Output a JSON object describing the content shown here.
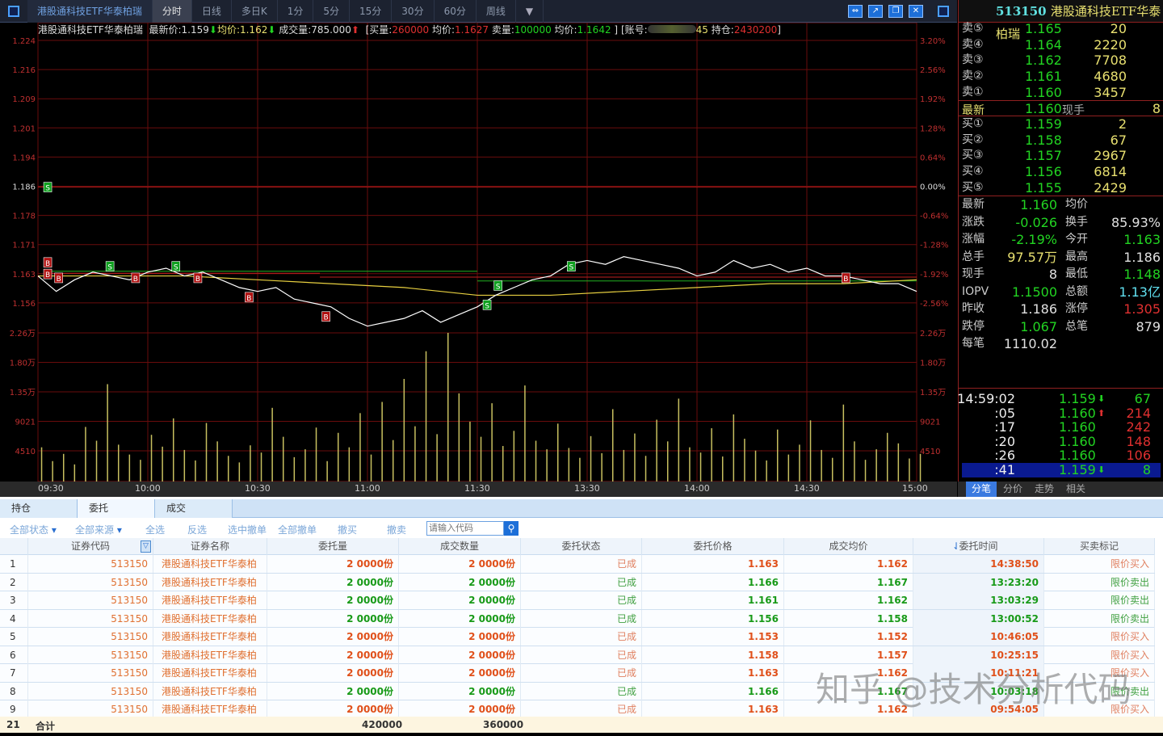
{
  "topbar": {
    "title": "港股通科技ETF华泰柏瑞",
    "tabs": [
      "分时",
      "日线",
      "多日K",
      "1分",
      "5分",
      "15分",
      "30分",
      "60分",
      "周线"
    ],
    "active_tab": "分时"
  },
  "info": {
    "name": "港股通科技ETF华泰柏瑞",
    "latest_label": "最新价:",
    "latest": "1.159",
    "avg_label": "均价:",
    "avg": "1.162",
    "vol_label": "成交量:",
    "vol": "785.000",
    "buy_label": "[买量:",
    "buy_qty": "260000",
    "buy_avg_label": "均价:",
    "buy_avg": "1.1627",
    "sell_label": "卖量:",
    "sell_qty": "100000",
    "sell_avg_label": "均价:",
    "sell_avg": "1.1642",
    "close_br": "]",
    "acct_label": "[账号:",
    "acct_tail": "45",
    "pos_label": "持仓:",
    "pos": "2430200",
    "close_br2": "]"
  },
  "chart_data": {
    "type": "line",
    "title": "港股通科技ETF华泰柏瑞 分时",
    "y_left_ticks": [
      "1.224",
      "1.216",
      "1.209",
      "1.201",
      "1.194",
      "1.186",
      "1.178",
      "1.171",
      "1.163",
      "1.156"
    ],
    "y_right_ticks": [
      "3.20%",
      "2.56%",
      "1.92%",
      "1.28%",
      "0.64%",
      "0.00%",
      "-0.64%",
      "-1.28%",
      "-1.92%",
      "-2.56%"
    ],
    "ylim": [
      1.156,
      1.224
    ],
    "prev_close": 1.186,
    "vol_ticks_left": [
      "2.26万",
      "1.80万",
      "1.35万",
      "9021",
      "4510"
    ],
    "vol_ticks_right": [
      "2.26万",
      "1.80万",
      "1.35万",
      "9021",
      "4510"
    ],
    "vol_max": 22600,
    "x_ticks": [
      "09:30",
      "10:00",
      "10:30",
      "11:00",
      "11:30",
      "13:30",
      "14:00",
      "14:30",
      "15:00"
    ],
    "price_minute_step": 5,
    "price": [
      1.163,
      1.159,
      1.162,
      1.164,
      1.163,
      1.162,
      1.164,
      1.165,
      1.163,
      1.164,
      1.162,
      1.16,
      1.159,
      1.16,
      1.157,
      1.156,
      1.155,
      1.152,
      1.15,
      1.151,
      1.152,
      1.154,
      1.151,
      1.153,
      1.155,
      1.158,
      1.16,
      1.162,
      1.163,
      1.166,
      1.167,
      1.166,
      1.168,
      1.167,
      1.166,
      1.165,
      1.163,
      1.164,
      1.167,
      1.165,
      1.166,
      1.164,
      1.165,
      1.163,
      1.163,
      1.162,
      1.161,
      1.161,
      1.159
    ],
    "avg_minute_step": 20,
    "avg": [
      1.163,
      1.163,
      1.163,
      1.162,
      1.161,
      1.16,
      1.158,
      1.158,
      1.159,
      1.16,
      1.161,
      1.161,
      1.162
    ],
    "sell_cost_line": [
      {
        "from": 3,
        "to": 120,
        "price": 1.1642
      },
      {
        "from": 120,
        "to": 240,
        "price": 1.1617
      }
    ],
    "buy_cost_line": [
      {
        "from": 3,
        "to": 77,
        "price": 1.1637
      },
      {
        "from": 77,
        "to": 240,
        "price": 1.1627
      }
    ],
    "markers": [
      {
        "t": "S",
        "m": 2,
        "p": 1.186
      },
      {
        "t": "B",
        "m": 2,
        "p": 1.1665
      },
      {
        "t": "B",
        "m": 2,
        "p": 1.1635
      },
      {
        "t": "B",
        "m": 5,
        "p": 1.1625
      },
      {
        "t": "S",
        "m": 19,
        "p": 1.1655
      },
      {
        "t": "B",
        "m": 26,
        "p": 1.1625
      },
      {
        "t": "S",
        "m": 37,
        "p": 1.1655
      },
      {
        "t": "B",
        "m": 43,
        "p": 1.1625
      },
      {
        "t": "B",
        "m": 57,
        "p": 1.1575
      },
      {
        "t": "B",
        "m": 78,
        "p": 1.1525
      },
      {
        "t": "S",
        "m": 122,
        "p": 1.1555
      },
      {
        "t": "S",
        "m": 125,
        "p": 1.1605
      },
      {
        "t": "S",
        "m": 145,
        "p": 1.1655
      },
      {
        "t": "B",
        "m": 220,
        "p": 1.1625
      }
    ],
    "vol_minute_step": 3,
    "volume": [
      5200,
      3100,
      4200,
      2600,
      8300,
      6200,
      14800,
      5600,
      4100,
      3300,
      7100,
      5300,
      9600,
      4800,
      3200,
      8900,
      6100,
      3900,
      2900,
      5500,
      4400,
      11200,
      6800,
      3700,
      4900,
      8200,
      3100,
      7400,
      5200,
      10400,
      4100,
      12100,
      6300,
      15600,
      8400,
      19800,
      7200,
      22600,
      13400,
      9100,
      6800,
      11900,
      5400,
      7700,
      14600,
      6200,
      4900,
      8800,
      5100,
      3600,
      6900,
      4300,
      11000,
      4800,
      7300,
      3900,
      9400,
      6100,
      12600,
      5200,
      4400,
      8100,
      3800,
      10200,
      6500,
      4700,
      3200,
      7900,
      4100,
      5600,
      9300,
      4800,
      3600,
      11700,
      6100,
      3300,
      4900,
      7400,
      5800,
      3500,
      4200
    ]
  },
  "right": {
    "code": "513150",
    "name": "港股通科技ETF华泰柏瑞",
    "asks": [
      {
        "label": "卖⑤",
        "price": "1.165",
        "qty": "20"
      },
      {
        "label": "卖④",
        "price": "1.164",
        "qty": "2220"
      },
      {
        "label": "卖③",
        "price": "1.162",
        "qty": "7708"
      },
      {
        "label": "卖②",
        "price": "1.161",
        "qty": "4680"
      },
      {
        "label": "卖①",
        "price": "1.160",
        "qty": "3457"
      }
    ],
    "last": {
      "label": "最新",
      "price": "1.160",
      "cur_label": "现手",
      "cur": "8"
    },
    "bids": [
      {
        "label": "买①",
        "price": "1.159",
        "qty": "2"
      },
      {
        "label": "买②",
        "price": "1.158",
        "qty": "67"
      },
      {
        "label": "买③",
        "price": "1.157",
        "qty": "2967"
      },
      {
        "label": "买④",
        "price": "1.156",
        "qty": "6814"
      },
      {
        "label": "买⑤",
        "price": "1.155",
        "qty": "2429"
      }
    ],
    "stats": [
      {
        "l1": "最新",
        "v1": "1.160",
        "c1": "g",
        "l2": "均价",
        "v2": "",
        "c2": "w"
      },
      {
        "l1": "涨跌",
        "v1": "-0.026",
        "c1": "g",
        "l2": "换手",
        "v2": "85.93%",
        "c2": "w"
      },
      {
        "l1": "涨幅",
        "v1": "-2.19%",
        "c1": "g",
        "l2": "今开",
        "v2": "1.163",
        "c2": "g"
      },
      {
        "l1": "总手",
        "v1": "97.57万",
        "c1": "y",
        "l2": "最高",
        "v2": "1.186",
        "c2": "w"
      },
      {
        "l1": "现手",
        "v1": "8",
        "c1": "w",
        "l2": "最低",
        "v2": "1.148",
        "c2": "g"
      },
      {
        "l1": "IOPV",
        "v1": "1.1500",
        "c1": "g",
        "l2": "总额",
        "v2": "1.13亿",
        "c2": "c"
      },
      {
        "l1": "昨收",
        "v1": "1.186",
        "c1": "w",
        "l2": "涨停",
        "v2": "1.305",
        "c2": "r"
      },
      {
        "l1": "跌停",
        "v1": "1.067",
        "c1": "g",
        "l2": "总笔",
        "v2": "879",
        "c2": "w"
      },
      {
        "l1": "每笔",
        "v1": "1110.02",
        "c1": "w",
        "l2": "",
        "v2": "",
        "c2": "w"
      }
    ],
    "ticks": [
      {
        "time": "14:59:02",
        "price": "1.159",
        "dir": "down",
        "qty": "67",
        "qc": "g"
      },
      {
        "time": ":05",
        "price": "1.160",
        "dir": "up",
        "qty": "214",
        "qc": "r"
      },
      {
        "time": ":17",
        "price": "1.160",
        "dir": "",
        "qty": "242",
        "qc": "r"
      },
      {
        "time": ":20",
        "price": "1.160",
        "dir": "",
        "qty": "148",
        "qc": "r"
      },
      {
        "time": ":26",
        "price": "1.160",
        "dir": "",
        "qty": "106",
        "qc": "r"
      },
      {
        "time": ":41",
        "price": "1.159",
        "dir": "down",
        "qty": "8",
        "qc": "g"
      }
    ],
    "tabs": [
      "分笔",
      "分价",
      "走势",
      "相关"
    ]
  },
  "bottom": {
    "tabs": [
      "持仓",
      "委托",
      "成交"
    ],
    "active_tab": "委托",
    "toolbar": {
      "status": "全部状态",
      "source": "全部来源",
      "select_all": "全选",
      "invert": "反选",
      "cancel_selected": "选中撤单",
      "cancel_all": "全部撤单",
      "cancel_buy": "撤买",
      "cancel_sell": "撤卖",
      "search_placeholder": "请输入代码"
    },
    "columns": [
      "证券代码",
      "证券名称",
      "委托量",
      "成交数量",
      "委托状态",
      "委托价格",
      "成交均价",
      "委托时间",
      "买卖标记"
    ],
    "rows": [
      {
        "no": "1",
        "code": "513150",
        "name": "港股通科技ETF华泰柏瑞",
        "qty": "2 0000份",
        "filled": "2 0000份",
        "status": "已成",
        "price": "1.163",
        "avg": "1.162",
        "time": "14:38:50",
        "side": "限价买入",
        "buy": true
      },
      {
        "no": "2",
        "code": "513150",
        "name": "港股通科技ETF华泰柏瑞",
        "qty": "2 0000份",
        "filled": "2 0000份",
        "status": "已成",
        "price": "1.166",
        "avg": "1.167",
        "time": "13:23:20",
        "side": "限价卖出",
        "buy": false
      },
      {
        "no": "3",
        "code": "513150",
        "name": "港股通科技ETF华泰柏瑞",
        "qty": "2 0000份",
        "filled": "2 0000份",
        "status": "已成",
        "price": "1.161",
        "avg": "1.162",
        "time": "13:03:29",
        "side": "限价卖出",
        "buy": false
      },
      {
        "no": "4",
        "code": "513150",
        "name": "港股通科技ETF华泰柏瑞",
        "qty": "2 0000份",
        "filled": "2 0000份",
        "status": "已成",
        "price": "1.156",
        "avg": "1.158",
        "time": "13:00:52",
        "side": "限价卖出",
        "buy": false
      },
      {
        "no": "5",
        "code": "513150",
        "name": "港股通科技ETF华泰柏瑞",
        "qty": "2 0000份",
        "filled": "2 0000份",
        "status": "已成",
        "price": "1.153",
        "avg": "1.152",
        "time": "10:46:05",
        "side": "限价买入",
        "buy": true
      },
      {
        "no": "6",
        "code": "513150",
        "name": "港股通科技ETF华泰柏瑞",
        "qty": "2 0000份",
        "filled": "2 0000份",
        "status": "已成",
        "price": "1.158",
        "avg": "1.157",
        "time": "10:25:15",
        "side": "限价买入",
        "buy": true
      },
      {
        "no": "7",
        "code": "513150",
        "name": "港股通科技ETF华泰柏瑞",
        "qty": "2 0000份",
        "filled": "2 0000份",
        "status": "已成",
        "price": "1.163",
        "avg": "1.162",
        "time": "10:11:21",
        "side": "限价买入",
        "buy": true
      },
      {
        "no": "8",
        "code": "513150",
        "name": "港股通科技ETF华泰柏瑞",
        "qty": "2 0000份",
        "filled": "2 0000份",
        "status": "已成",
        "price": "1.166",
        "avg": "1.167",
        "time": "10:03:18",
        "side": "限价卖出",
        "buy": false
      },
      {
        "no": "9",
        "code": "513150",
        "name": "港股通科技ETF华泰柏瑞",
        "qty": "2 0000份",
        "filled": "2 0000份",
        "status": "已成",
        "price": "1.163",
        "avg": "1.162",
        "time": "09:54:05",
        "side": "限价买入",
        "buy": true
      }
    ],
    "footer": {
      "count": "21",
      "label": "合计",
      "qty_total": "420000",
      "filled_total": "360000"
    }
  },
  "watermark": "知乎 @技术分析代码",
  "colors": {
    "buy": "#e0501a",
    "sell": "#189a18",
    "grid": "#8a1010",
    "price": "#ffffff",
    "avg": "#e8d040",
    "vol": "#c8c060"
  }
}
